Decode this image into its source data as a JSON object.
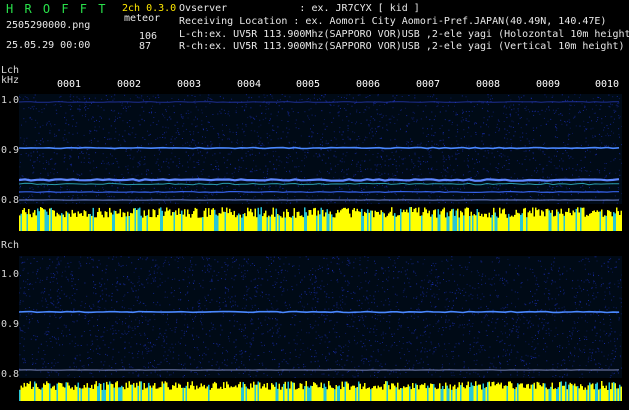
{
  "header": {
    "logo": "H R O F F T",
    "version": "2ch 0.3.0",
    "filename": "2505290000.png",
    "kind": "meteor",
    "datetime": "25.05.29 00:00",
    "count_l": "106",
    "count_r": "87",
    "observer": "Ovserver            : ex. JR7CYX [ kid ]",
    "location": "Receiving Location : ex. Aomori City Aomori-Pref.JAPAN(40.49N, 140.47E)",
    "lch": "L-ch:ex. UV5R 113.900Mhz(SAPPORO VOR)USB ,2-ele yagi (Holozontal 10m height)",
    "rch": "R-ch:ex. UV5R 113.900Mhz(SAPPORO VOR)USB ,2-ele yagi (Vertical 10m height)"
  },
  "lch_panel": {
    "label": "Lch",
    "unit": "kHz",
    "y_ticks": [
      "1.0",
      "0.9",
      "0.8"
    ]
  },
  "rch_panel": {
    "label": "Rch",
    "y_ticks": [
      "1.0",
      "0.9",
      "0.8"
    ]
  },
  "time_ticks": [
    "0001",
    "0002",
    "0003",
    "0004",
    "0005",
    "0006",
    "0007",
    "0008",
    "0009",
    "0010"
  ],
  "colors": {
    "background": "#000000",
    "noise_blue": "#1a2fb8",
    "signal_line": "#4a88ff",
    "level_yellow": "#ffff00",
    "level_cyan": "#29c6d6",
    "logo_green": "#29e04a"
  }
}
